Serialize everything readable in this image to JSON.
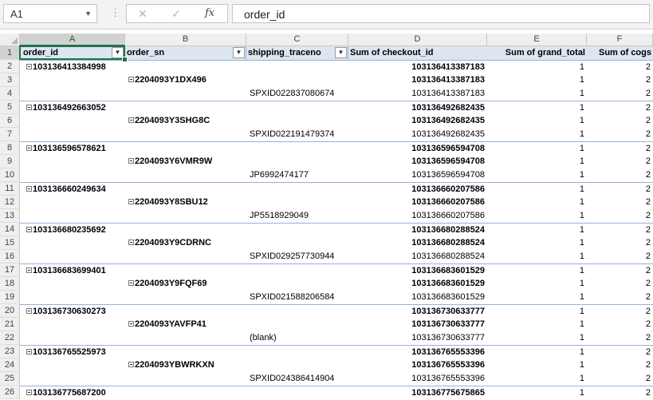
{
  "formula_bar": {
    "name_box": "A1",
    "dots": "⋮",
    "cancel": "✕",
    "enter": "✓",
    "fx": "fx",
    "formula": "order_id"
  },
  "columns": [
    "A",
    "B",
    "C",
    "D",
    "E",
    "F"
  ],
  "header": {
    "order_id": "order_id",
    "order_sn": "order_sn",
    "shipping_traceno": "shipping_traceno",
    "sum_checkout_id": "Sum of checkout_id",
    "sum_grand_total": "Sum of grand_total",
    "sum_cogs": "Sum of cogs"
  },
  "rows": [
    {
      "num": "1"
    },
    {
      "num": "2",
      "a": "103136413384998",
      "d": "103136413387183",
      "e": "1",
      "f": "2",
      "bold": true,
      "sep": true
    },
    {
      "num": "3",
      "b": "2204093Y1DX496",
      "d": "103136413387183",
      "e": "1",
      "f": "2",
      "bold": true
    },
    {
      "num": "4",
      "c": "SPXID022837080674",
      "d": "103136413387183",
      "e": "1",
      "f": "2"
    },
    {
      "num": "5",
      "a": "103136492663052",
      "d": "103136492682435",
      "e": "1",
      "f": "2",
      "bold": true,
      "sep": true
    },
    {
      "num": "6",
      "b": "2204093Y3SHG8C",
      "d": "103136492682435",
      "e": "1",
      "f": "2",
      "bold": true
    },
    {
      "num": "7",
      "c": "SPXID022191479374",
      "d": "103136492682435",
      "e": "1",
      "f": "2"
    },
    {
      "num": "8",
      "a": "103136596578621",
      "d": "103136596594708",
      "e": "1",
      "f": "2",
      "bold": true,
      "sep": true
    },
    {
      "num": "9",
      "b": "2204093Y6VMR9W",
      "d": "103136596594708",
      "e": "1",
      "f": "2",
      "bold": true
    },
    {
      "num": "10",
      "c": "JP6992474177",
      "d": "103136596594708",
      "e": "1",
      "f": "2"
    },
    {
      "num": "11",
      "a": "103136660249634",
      "d": "103136660207586",
      "e": "1",
      "f": "2",
      "bold": true,
      "sep": true
    },
    {
      "num": "12",
      "b": "2204093Y8SBU12",
      "d": "103136660207586",
      "e": "1",
      "f": "2",
      "bold": true
    },
    {
      "num": "13",
      "c": "JP5518929049",
      "d": "103136660207586",
      "e": "1",
      "f": "2"
    },
    {
      "num": "14",
      "a": "103136680235692",
      "d": "103136680288524",
      "e": "1",
      "f": "2",
      "bold": true,
      "sep": true
    },
    {
      "num": "15",
      "b": "2204093Y9CDRNC",
      "d": "103136680288524",
      "e": "1",
      "f": "2",
      "bold": true
    },
    {
      "num": "16",
      "c": "SPXID029257730944",
      "d": "103136680288524",
      "e": "1",
      "f": "2"
    },
    {
      "num": "17",
      "a": "103136683699401",
      "d": "103136683601529",
      "e": "1",
      "f": "2",
      "bold": true,
      "sep": true
    },
    {
      "num": "18",
      "b": "2204093Y9FQF69",
      "d": "103136683601529",
      "e": "1",
      "f": "2",
      "bold": true
    },
    {
      "num": "19",
      "c": "SPXID021588206584",
      "d": "103136683601529",
      "e": "1",
      "f": "2"
    },
    {
      "num": "20",
      "a": "103136730630273",
      "d": "103136730633777",
      "e": "1",
      "f": "2",
      "bold": true,
      "sep": true
    },
    {
      "num": "21",
      "b": "2204093YAVFP41",
      "d": "103136730633777",
      "e": "1",
      "f": "2",
      "bold": true
    },
    {
      "num": "22",
      "c": "(blank)",
      "d": "103136730633777",
      "e": "1",
      "f": "2"
    },
    {
      "num": "23",
      "a": "103136765525973",
      "d": "103136765553396",
      "e": "1",
      "f": "2",
      "bold": true,
      "sep": true
    },
    {
      "num": "24",
      "b": "2204093YBWRKXN",
      "d": "103136765553396",
      "e": "1",
      "f": "2",
      "bold": true
    },
    {
      "num": "25",
      "c": "SPXID024386414904",
      "d": "103136765553396",
      "e": "1",
      "f": "2"
    },
    {
      "num": "26",
      "a": "103136775687200",
      "d": "103136775675865",
      "e": "1",
      "f": "2",
      "bold": true,
      "sep": true
    }
  ]
}
